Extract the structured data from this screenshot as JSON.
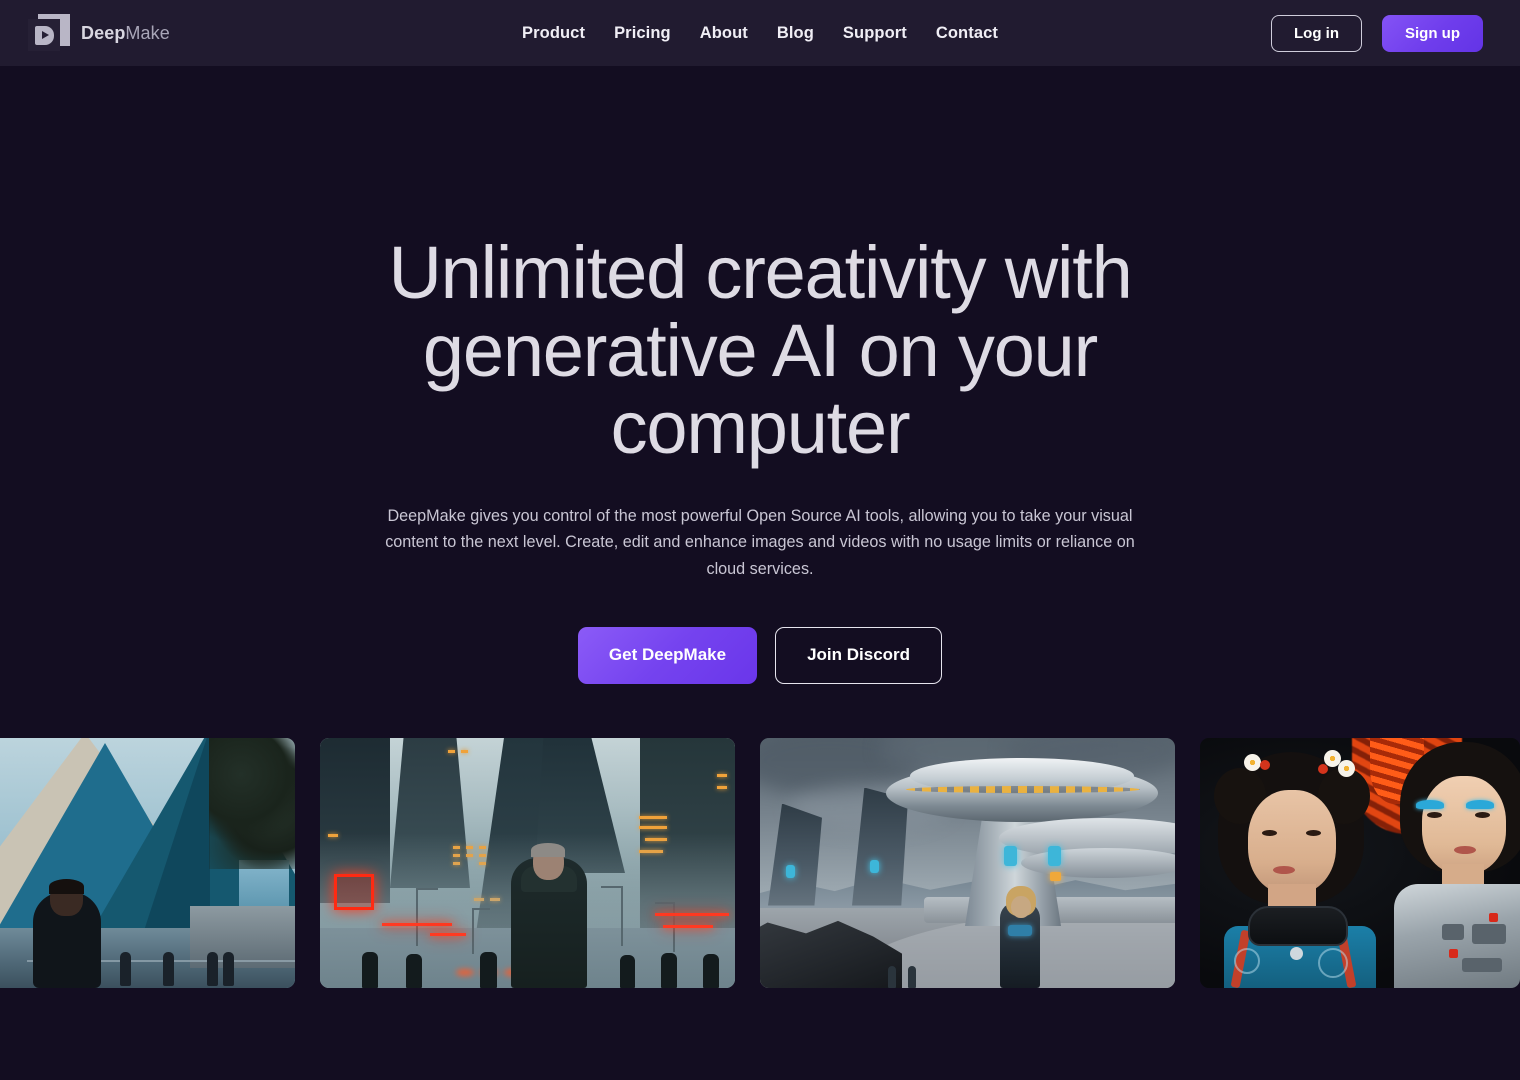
{
  "brand": {
    "name_bold": "Deep",
    "name_light": "Make",
    "logo_icon": "deepmake-play-logo"
  },
  "nav": {
    "items": [
      {
        "label": "Product"
      },
      {
        "label": "Pricing"
      },
      {
        "label": "About"
      },
      {
        "label": "Blog"
      },
      {
        "label": "Support"
      },
      {
        "label": "Contact"
      }
    ]
  },
  "auth": {
    "login_label": "Log in",
    "signup_label": "Sign up"
  },
  "hero": {
    "headline": "Unlimited creativity with generative AI on your computer",
    "subheadline": "DeepMake gives you control of the most powerful Open Source AI tools, allowing you to take your visual content to the next level. Create, edit and enhance images and videos with no usage limits or reliance on cloud services.",
    "cta_primary": "Get DeepMake",
    "cta_secondary": "Join Discord"
  },
  "gallery": {
    "items": [
      {
        "alt": "Blue glass pyramids city street with man smoking"
      },
      {
        "alt": "Foggy cyberpunk city street with man in long dark coat and red neon signs"
      },
      {
        "alt": "Futuristic spaceport with saucer structure and woman walking"
      },
      {
        "alt": "Two cyberpunk geisha androids with flower hairpins"
      }
    ]
  },
  "colors": {
    "page_background": "#130d21",
    "header_background": "#211b30",
    "accent_purple": "#7543ef",
    "accent_purple_light": "#8b5bf7",
    "heading_text": "#dedbe4",
    "body_text": "#c9c6d4",
    "nav_text": "#f0eef5"
  }
}
